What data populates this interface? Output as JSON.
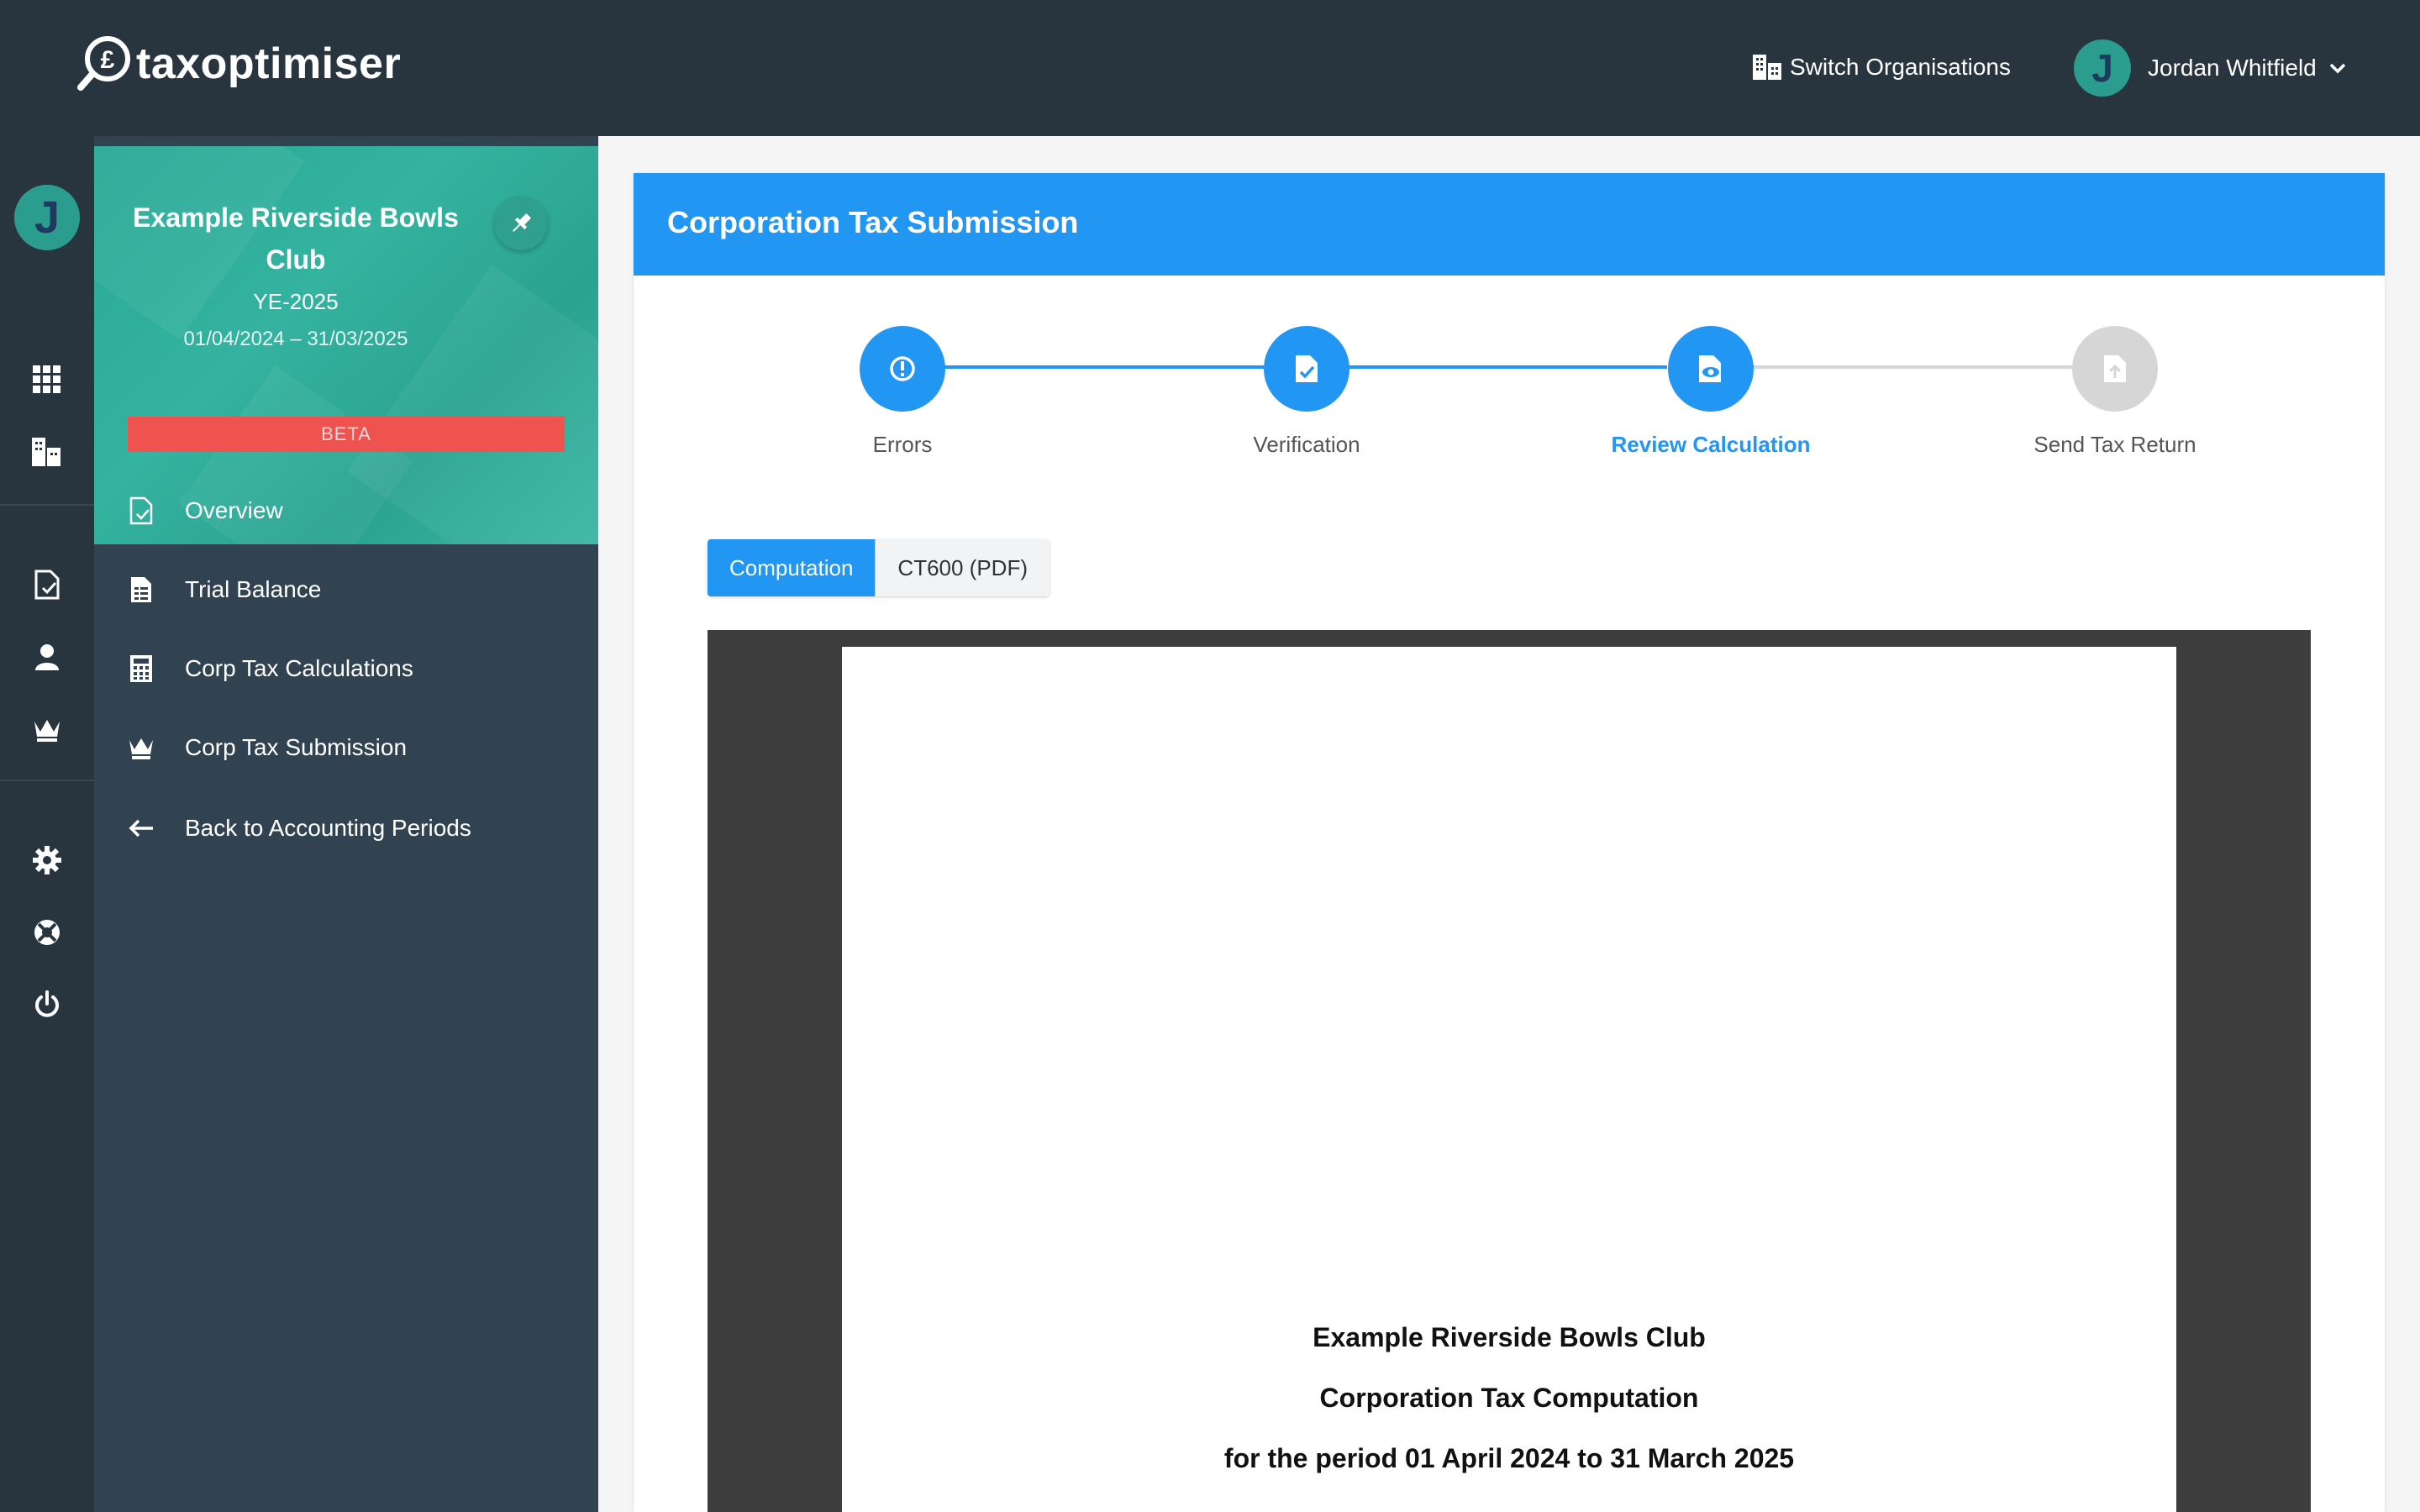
{
  "app": {
    "logo_text": "taxoptimiser"
  },
  "topbar": {
    "switch_org_label": "Switch Organisations",
    "user_initial": "J",
    "user_name": "Jordan Whitfield"
  },
  "rail": {
    "avatar_initial": "J"
  },
  "sidebar": {
    "org_name": "Example Riverside Bowls Club",
    "year_end": "YE-2025",
    "period": "01/04/2024 – 31/03/2025",
    "badge": "BETA",
    "items": [
      {
        "label": "Overview",
        "icon": "document-check-icon"
      },
      {
        "label": "Trial Balance",
        "icon": "spreadsheet-icon"
      },
      {
        "label": "Corp Tax Calculations",
        "icon": "calculator-icon"
      },
      {
        "label": "Corp Tax Submission",
        "icon": "crown-icon"
      },
      {
        "label": "Back to Accounting Periods",
        "icon": "arrow-left-icon"
      }
    ]
  },
  "main": {
    "title": "Corporation Tax Submission",
    "steps": [
      {
        "label": "Errors",
        "state": "complete"
      },
      {
        "label": "Verification",
        "state": "complete"
      },
      {
        "label": "Review Calculation",
        "state": "active"
      },
      {
        "label": "Send Tax Return",
        "state": "pending"
      }
    ],
    "tabs": [
      {
        "label": "Computation",
        "active": true
      },
      {
        "label": "CT600 (PDF)",
        "active": false
      }
    ],
    "document": {
      "line1": "Example Riverside Bowls Club",
      "line2": "Corporation Tax Computation",
      "line3": "for the period 01 April 2024 to 31 March 2025"
    }
  },
  "colors": {
    "topbar": "#29353e",
    "sidebar": "#314350",
    "org_card": "#2aa896",
    "accent": "#2196f3",
    "beta": "#ef5350",
    "step_pending": "#d6d6d6",
    "viewer_bg": "#3d3d3d"
  }
}
